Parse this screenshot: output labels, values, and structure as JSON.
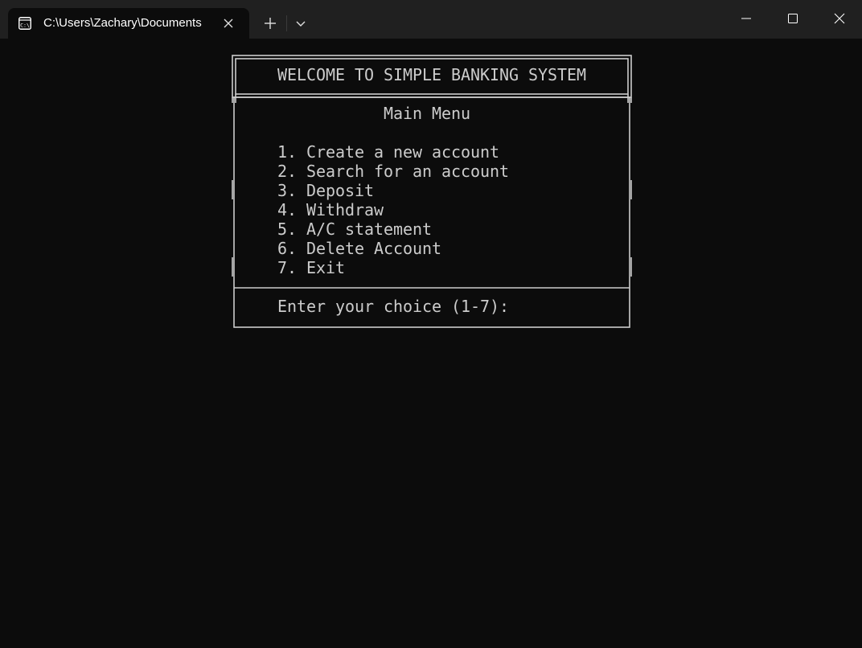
{
  "tab": {
    "icon": "terminal-prompt-icon",
    "icon_text": "C:\\",
    "title": "C:\\Users\\Zachary\\Documents"
  },
  "titlebar_icons": {
    "close_tab": "close-icon",
    "new_tab": "plus-icon",
    "dropdown": "chevron-down-icon",
    "minimize": "minimize-icon",
    "maximize": "maximize-icon",
    "close_window": "close-icon"
  },
  "colors": {
    "terminal_bg": "#0c0c0c",
    "titlebar_bg": "#202020",
    "text": "#cccccc"
  },
  "console": {
    "banner": "WELCOME TO SIMPLE BANKING SYSTEM",
    "menu_title": "Main Menu",
    "menu_items": [
      "1. Create a new account",
      "2. Search for an account",
      "3. Deposit",
      "4. Withdraw",
      "5. A/C statement",
      "6. Delete Account",
      "7. Exit"
    ],
    "prompt": "Enter your choice (1-7):"
  }
}
